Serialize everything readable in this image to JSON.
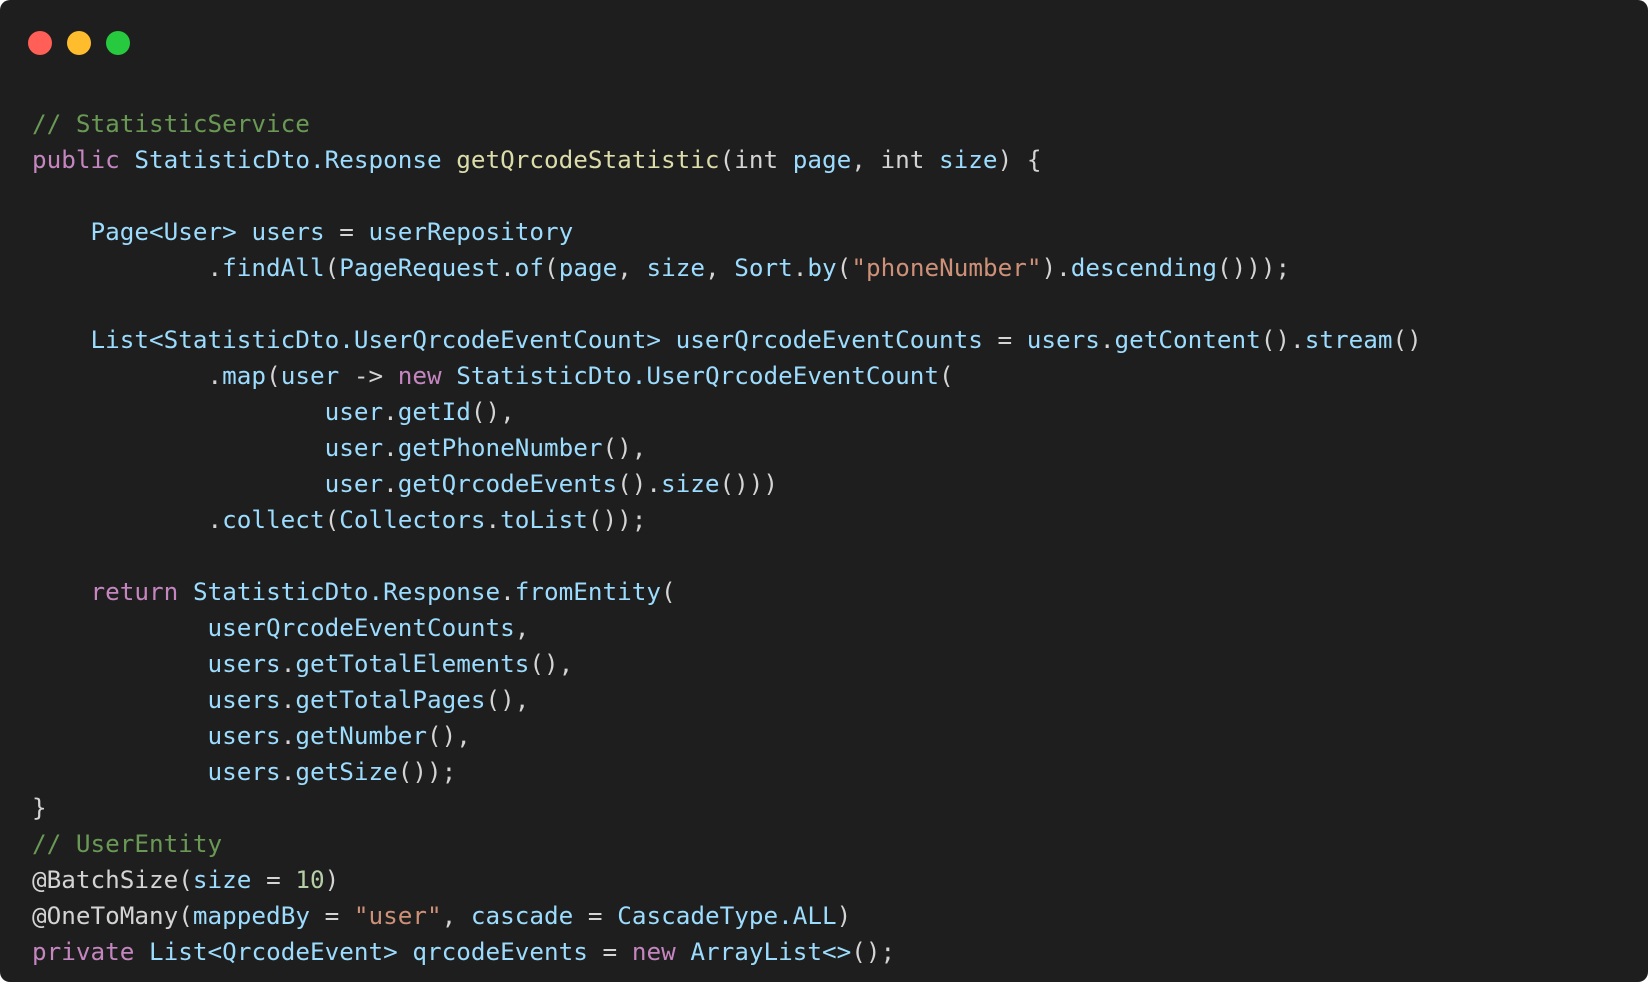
{
  "window": {
    "controls": {
      "close_color": "#ff5f56",
      "minimize_color": "#ffbd2e",
      "maximize_color": "#27c93f"
    }
  },
  "code": {
    "lines": [
      [
        [
          "comment",
          "// StatisticService"
        ]
      ],
      [
        [
          "keyword",
          "public"
        ],
        [
          "plain",
          " "
        ],
        [
          "type",
          "StatisticDto.Response"
        ],
        [
          "plain",
          " "
        ],
        [
          "func",
          "getQrcodeStatistic"
        ],
        [
          "plain",
          "("
        ],
        [
          "plain",
          "int"
        ],
        [
          "plain",
          " "
        ],
        [
          "var",
          "page"
        ],
        [
          "plain",
          ", "
        ],
        [
          "plain",
          "int"
        ],
        [
          "plain",
          " "
        ],
        [
          "var",
          "size"
        ],
        [
          "plain",
          ") {"
        ]
      ],
      [],
      [
        [
          "plain",
          "    "
        ],
        [
          "type",
          "Page<User>"
        ],
        [
          "plain",
          " "
        ],
        [
          "var",
          "users"
        ],
        [
          "plain",
          " = "
        ],
        [
          "var",
          "userRepository"
        ]
      ],
      [
        [
          "plain",
          "            ."
        ],
        [
          "method",
          "findAll"
        ],
        [
          "plain",
          "("
        ],
        [
          "type",
          "PageRequest"
        ],
        [
          "plain",
          "."
        ],
        [
          "method",
          "of"
        ],
        [
          "plain",
          "("
        ],
        [
          "var",
          "page"
        ],
        [
          "plain",
          ", "
        ],
        [
          "var",
          "size"
        ],
        [
          "plain",
          ", "
        ],
        [
          "type",
          "Sort"
        ],
        [
          "plain",
          "."
        ],
        [
          "method",
          "by"
        ],
        [
          "plain",
          "("
        ],
        [
          "string",
          "\"phoneNumber\""
        ],
        [
          "plain",
          ")."
        ],
        [
          "method",
          "descending"
        ],
        [
          "plain",
          "()));"
        ]
      ],
      [],
      [
        [
          "plain",
          "    "
        ],
        [
          "type",
          "List<StatisticDto.UserQrcodeEventCount>"
        ],
        [
          "plain",
          " "
        ],
        [
          "var",
          "userQrcodeEventCounts"
        ],
        [
          "plain",
          " = "
        ],
        [
          "var",
          "users"
        ],
        [
          "plain",
          "."
        ],
        [
          "method",
          "getContent"
        ],
        [
          "plain",
          "()."
        ],
        [
          "method",
          "stream"
        ],
        [
          "plain",
          "()"
        ]
      ],
      [
        [
          "plain",
          "            ."
        ],
        [
          "method",
          "map"
        ],
        [
          "plain",
          "("
        ],
        [
          "var",
          "user"
        ],
        [
          "plain",
          " -> "
        ],
        [
          "keyword",
          "new"
        ],
        [
          "plain",
          " "
        ],
        [
          "type",
          "StatisticDto.UserQrcodeEventCount"
        ],
        [
          "plain",
          "("
        ]
      ],
      [
        [
          "plain",
          "                    "
        ],
        [
          "var",
          "user"
        ],
        [
          "plain",
          "."
        ],
        [
          "method",
          "getId"
        ],
        [
          "plain",
          "(),"
        ]
      ],
      [
        [
          "plain",
          "                    "
        ],
        [
          "var",
          "user"
        ],
        [
          "plain",
          "."
        ],
        [
          "method",
          "getPhoneNumber"
        ],
        [
          "plain",
          "(),"
        ]
      ],
      [
        [
          "plain",
          "                    "
        ],
        [
          "var",
          "user"
        ],
        [
          "plain",
          "."
        ],
        [
          "method",
          "getQrcodeEvents"
        ],
        [
          "plain",
          "()."
        ],
        [
          "method",
          "size"
        ],
        [
          "plain",
          "()))"
        ]
      ],
      [
        [
          "plain",
          "            ."
        ],
        [
          "method",
          "collect"
        ],
        [
          "plain",
          "("
        ],
        [
          "type",
          "Collectors"
        ],
        [
          "plain",
          "."
        ],
        [
          "method",
          "toList"
        ],
        [
          "plain",
          "());"
        ]
      ],
      [],
      [
        [
          "plain",
          "    "
        ],
        [
          "keyword",
          "return"
        ],
        [
          "plain",
          " "
        ],
        [
          "type",
          "StatisticDto.Response"
        ],
        [
          "plain",
          "."
        ],
        [
          "method",
          "fromEntity"
        ],
        [
          "plain",
          "("
        ]
      ],
      [
        [
          "plain",
          "            "
        ],
        [
          "var",
          "userQrcodeEventCounts"
        ],
        [
          "plain",
          ","
        ]
      ],
      [
        [
          "plain",
          "            "
        ],
        [
          "var",
          "users"
        ],
        [
          "plain",
          "."
        ],
        [
          "method",
          "getTotalElements"
        ],
        [
          "plain",
          "(),"
        ]
      ],
      [
        [
          "plain",
          "            "
        ],
        [
          "var",
          "users"
        ],
        [
          "plain",
          "."
        ],
        [
          "method",
          "getTotalPages"
        ],
        [
          "plain",
          "(),"
        ]
      ],
      [
        [
          "plain",
          "            "
        ],
        [
          "var",
          "users"
        ],
        [
          "plain",
          "."
        ],
        [
          "method",
          "getNumber"
        ],
        [
          "plain",
          "(),"
        ]
      ],
      [
        [
          "plain",
          "            "
        ],
        [
          "var",
          "users"
        ],
        [
          "plain",
          "."
        ],
        [
          "method",
          "getSize"
        ],
        [
          "plain",
          "());"
        ]
      ],
      [
        [
          "plain",
          "}"
        ]
      ],
      [
        [
          "comment",
          "// UserEntity"
        ]
      ],
      [
        [
          "annotation",
          "@BatchSize"
        ],
        [
          "plain",
          "("
        ],
        [
          "var",
          "size"
        ],
        [
          "plain",
          " = "
        ],
        [
          "number",
          "10"
        ],
        [
          "plain",
          ")"
        ]
      ],
      [
        [
          "annotation",
          "@OneToMany"
        ],
        [
          "plain",
          "("
        ],
        [
          "var",
          "mappedBy"
        ],
        [
          "plain",
          " = "
        ],
        [
          "string",
          "\"user\""
        ],
        [
          "plain",
          ", "
        ],
        [
          "var",
          "cascade"
        ],
        [
          "plain",
          " = "
        ],
        [
          "type",
          "CascadeType.ALL"
        ],
        [
          "plain",
          ")"
        ]
      ],
      [
        [
          "keyword",
          "private"
        ],
        [
          "plain",
          " "
        ],
        [
          "type",
          "List<QrcodeEvent>"
        ],
        [
          "plain",
          " "
        ],
        [
          "var",
          "qrcodeEvents"
        ],
        [
          "plain",
          " = "
        ],
        [
          "keyword",
          "new"
        ],
        [
          "plain",
          " "
        ],
        [
          "type",
          "ArrayList<>"
        ],
        [
          "plain",
          "();"
        ]
      ]
    ]
  }
}
